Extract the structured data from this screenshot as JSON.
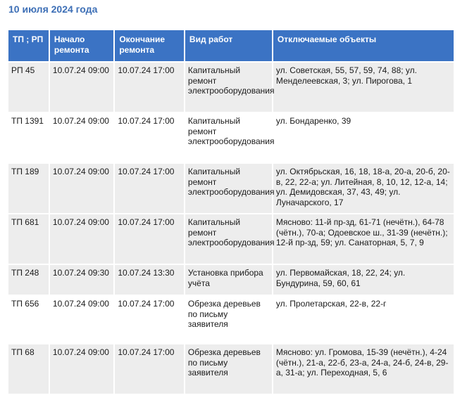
{
  "date_heading": "10 июля 2024 года",
  "columns": [
    "ТП ; РП",
    "Начало ремонта",
    "Окончание ремонта",
    "Вид работ",
    "Отключаемые объекты"
  ],
  "rows": [
    {
      "tp": "РП 45",
      "start": "10.07.24 09:00",
      "end": "10.07.24 17:00",
      "work": "Капитальный ремонт электрооборудования",
      "objects": "ул. Советская, 55, 57, 59, 74, 88; ул. Менделеевская, 3; ул. Пирогова, 1"
    },
    {
      "tp": "ТП 1391",
      "start": "10.07.24 09:00",
      "end": "10.07.24 17:00",
      "work": "Капитальный ремонт электрооборудования",
      "objects": "ул. Бондаренко, 39"
    },
    {
      "tp": "ТП 189",
      "start": "10.07.24 09:00",
      "end": "10.07.24 17:00",
      "work": "Капитальный ремонт электрооборудования",
      "objects": "ул. Октябрьская, 16, 18, 18-а,  20-а, 20-б, 20-в, 22, 22-а; ул. Литейная, 8, 10, 12, 12-а, 14; ул. Демидовская, 37, 43, 49; ул. Луначарского, 17"
    },
    {
      "tp": "ТП 681",
      "start": "10.07.24 09:00",
      "end": "10.07.24 17:00",
      "work": "Капитальный ремонт электрооборудования",
      "objects": "Мясново: 11-й пр-зд, 61-71 (нечётн.), 64-78 (чётн.), 70-а; Одоевское ш., 31-39 (нечётн.); 12-й пр-зд, 59; ул. Санаторная, 5, 7, 9"
    },
    {
      "tp": "ТП 248",
      "start": "10.07.24 09:30",
      "end": "10.07.24 13:30",
      "work": "Установка прибора учёта",
      "objects": "ул. Первомайская, 18, 22, 24; ул. Бундурина, 59, 60, 61"
    },
    {
      "tp": "ТП 656",
      "start": "10.07.24 09:00",
      "end": "10.07.24 17:00",
      "work": "Обрезка деревьев по письму заявителя",
      "objects": "ул. Пролетарская, 22-в, 22-г"
    },
    {
      "tp": "ТП 68",
      "start": "10.07.24 09:00",
      "end": "10.07.24 17:00",
      "work": "Обрезка деревьев по письму заявителя",
      "objects": "Мясново: ул. Громова, 15-39 (нечётн.), 4-24 (чётн.), 21-а, 22-б, 23-а, 24-а, 24-б, 24-в, 29-а, 31-а; ул. Переходная, 5, 6"
    }
  ],
  "colors": {
    "heading": "#3d6fb6",
    "header_bg": "#3b73c4",
    "row_gray": "#ededed"
  }
}
